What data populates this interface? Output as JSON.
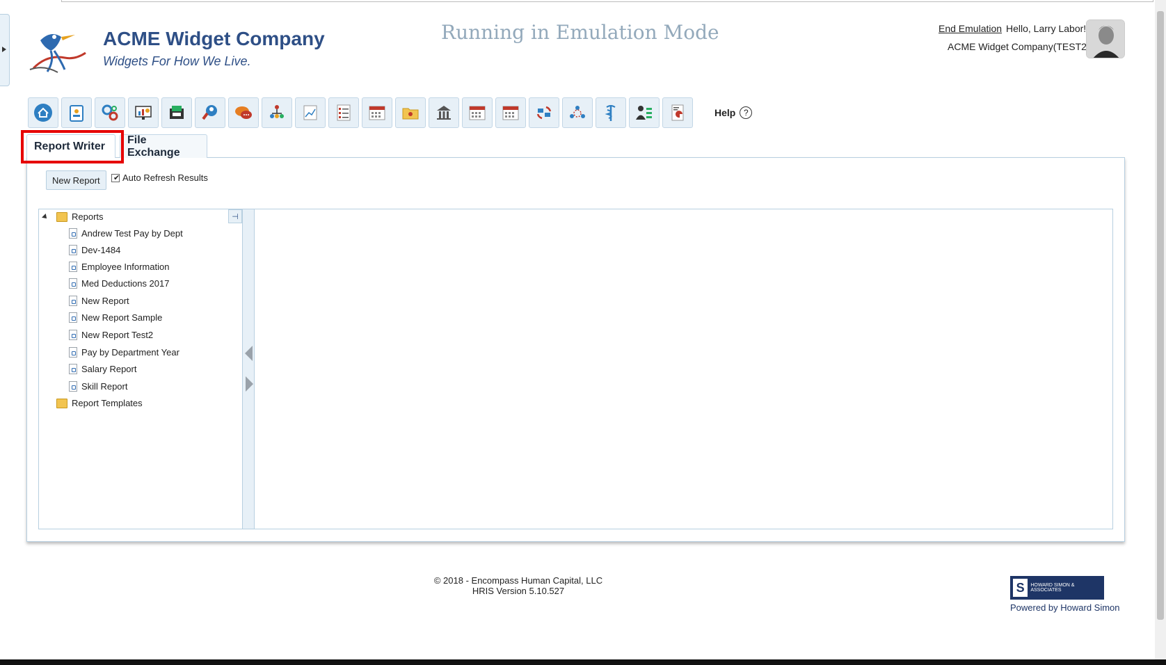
{
  "header": {
    "company_name": "ACME Widget Company",
    "tagline": "Widgets For How We Live.",
    "emulation_title": "Running in Emulation Mode",
    "end_emulation": "End Emulation",
    "greeting": "Hello, Larry Labor!",
    "company_code": "ACME Widget Company(TEST2)"
  },
  "toolbar": {
    "icons": [
      "home-icon",
      "id-badge-icon",
      "gears-icon",
      "dashboard-icon",
      "payroll-icon",
      "search-person-icon",
      "chat-icon",
      "org-chart-icon",
      "chart-icon",
      "checklist-icon",
      "calendar-icon",
      "folder-icon",
      "building-icon",
      "calendar-icon",
      "calendar-icon",
      "sync-icon",
      "team-icon",
      "medical-icon",
      "employee-move-icon",
      "report-icon"
    ],
    "help_label": "Help",
    "help_symbol": "?"
  },
  "tabs": [
    {
      "label": "Report Writer",
      "active": true
    },
    {
      "label": "File Exchange",
      "active": false
    }
  ],
  "actions": {
    "new_report": "New Report",
    "auto_refresh": "Auto Refresh Results",
    "auto_refresh_checked": true
  },
  "tree": {
    "root": "Reports",
    "items": [
      "Andrew Test Pay by Dept",
      "Dev-1484",
      "Employee Information",
      "Med Deductions 2017",
      "New Report",
      "New Report Sample",
      "New Report Test2",
      "Pay by Department Year",
      "Salary Report",
      "Skill Report"
    ],
    "templates": "Report Templates",
    "pin_symbol": "⊣"
  },
  "footer": {
    "copyright": "© 2018 - Encompass Human Capital, LLC",
    "version": "HRIS Version 5.10.527",
    "partner_logo_text": "HOWARD SIMON & ASSOCIATES",
    "powered_by": "Powered by Howard Simon"
  },
  "colors": {
    "brand": "#2e4f86",
    "emulation": "#93a9bb",
    "highlight": "#e60000",
    "toolbar_bg": "#e7f0f7"
  }
}
